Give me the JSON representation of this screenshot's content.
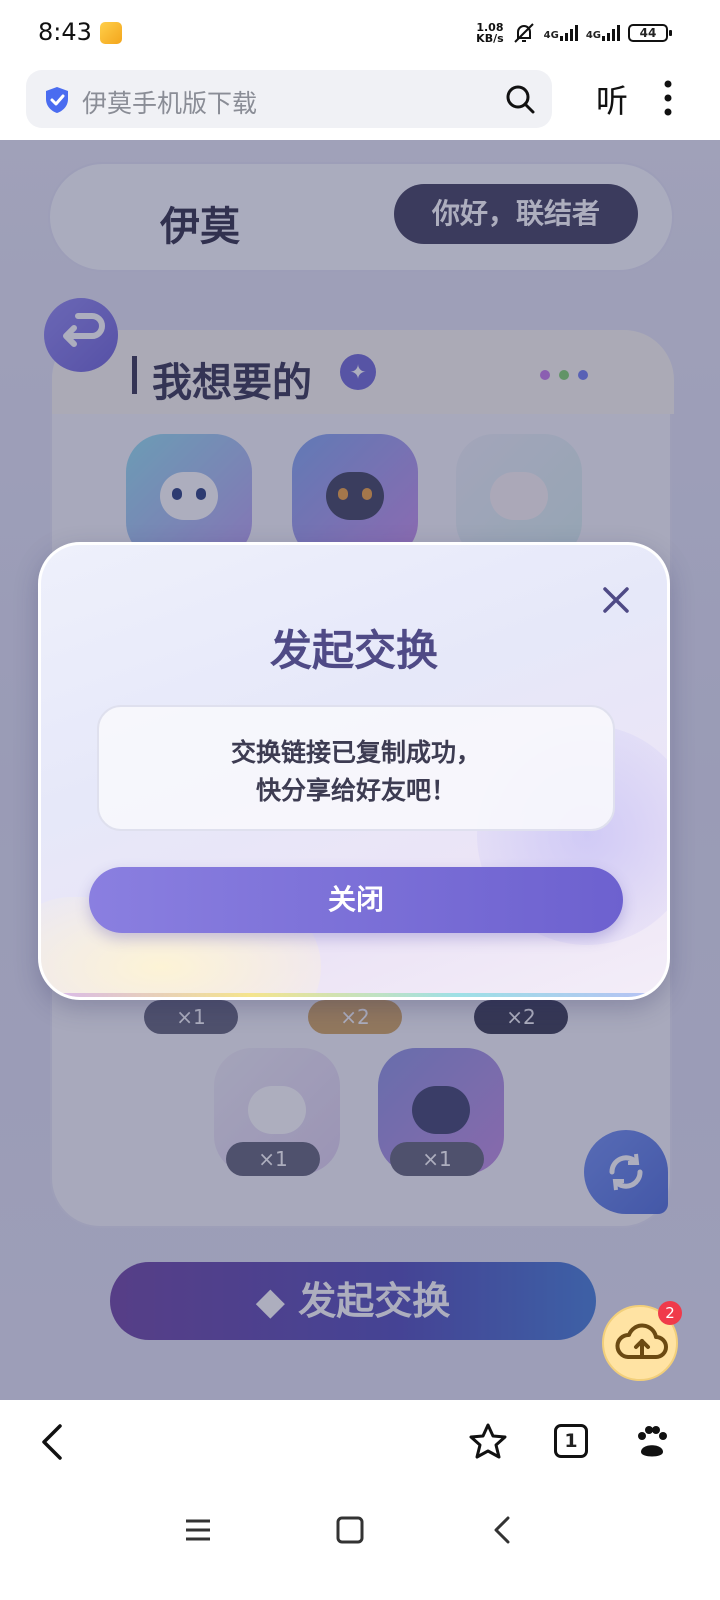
{
  "status_bar": {
    "time": "8:43",
    "net_speed_value": "1.08",
    "net_speed_unit": "KB/s",
    "signal1_label": "4G",
    "signal2_label": "4G",
    "battery": "44"
  },
  "browser": {
    "url_text": "伊莫手机版下载",
    "listen_label": "听"
  },
  "page": {
    "logo": "伊莫",
    "greeting": "你好，联结者",
    "want_title": "我想要的",
    "counts": [
      "×1",
      "×2",
      "×2",
      "×1",
      "×1"
    ],
    "exchange_button": "发起交换",
    "cloud_badge": "2"
  },
  "modal": {
    "title": "发起交换",
    "message_line1": "交换链接已复制成功，",
    "message_line2": "快分享给好友吧！",
    "close_button": "关闭"
  },
  "toolbar": {
    "tabs_count": "1"
  },
  "colors": {
    "accent": "#6d61cf",
    "modal_title": "#4f4a86"
  },
  "icons": [
    "shield-icon",
    "search-icon",
    "more-icon",
    "close-icon",
    "back-icon",
    "star-icon",
    "paw-icon",
    "menu-icon",
    "home-icon"
  ]
}
